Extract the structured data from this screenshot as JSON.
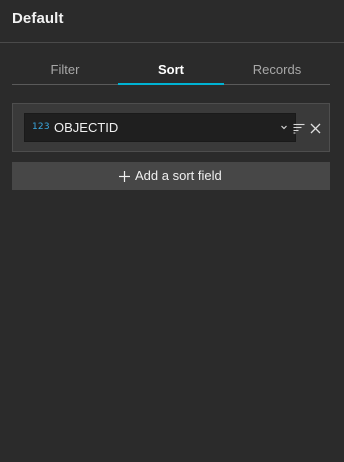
{
  "header": {
    "title": "Default"
  },
  "tabs": [
    {
      "label": "Filter",
      "active": false
    },
    {
      "label": "Sort",
      "active": true
    },
    {
      "label": "Records",
      "active": false
    }
  ],
  "sort_fields": [
    {
      "type_badge": "123",
      "field": "OBJECTID",
      "icons": [
        "chevron-down-icon",
        "sort-order-icon",
        "close-icon"
      ]
    }
  ],
  "add_sort": {
    "label": "Add a sort field",
    "icon": "plus-icon"
  },
  "colors": {
    "background": "#2b2b2b",
    "accent": "#00b3d4",
    "type_badge": "#3aa8e0",
    "button": "#474747",
    "select": "#1f1f1f"
  }
}
